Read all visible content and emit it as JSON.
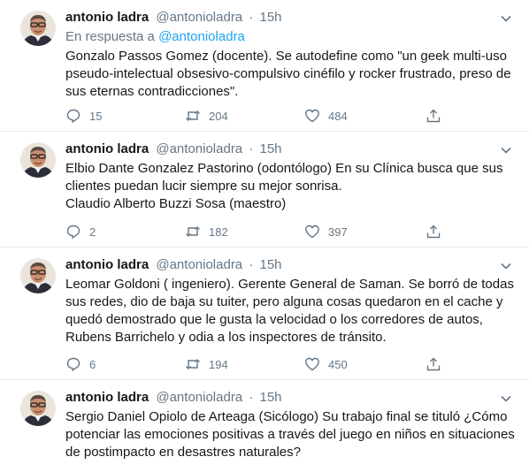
{
  "colors": {
    "text": "#14171a",
    "secondary": "#657786",
    "link": "#1da1f2",
    "divider": "#e6ecf0"
  },
  "tweets": [
    {
      "name": "antonio ladra",
      "handle": "@antonioladra",
      "separator": "·",
      "time": "15h",
      "reply_prefix": "En respuesta a",
      "reply_handle": "@antonioladra",
      "lines": [
        "Gonzalo Passos Gomez (docente). Se autodefine como \"un geek multi-uso pseudo-intelectual obsesivo-compulsivo cinéfilo y rocker frustrado, preso de sus eternas contradicciones\"."
      ],
      "replies": "15",
      "retweets": "204",
      "likes": "484"
    },
    {
      "name": "antonio ladra",
      "handle": "@antonioladra",
      "separator": "·",
      "time": "15h",
      "lines": [
        "Elbio Dante Gonzalez Pastorino (odontólogo) En su Clínica busca que sus clientes puedan lucir siempre su mejor sonrisa.",
        "Claudio Alberto Buzzi Sosa (maestro)"
      ],
      "replies": "2",
      "retweets": "182",
      "likes": "397"
    },
    {
      "name": "antonio ladra",
      "handle": "@antonioladra",
      "separator": "·",
      "time": "15h",
      "lines": [
        "Leomar Goldoni ( ingeniero). Gerente General de Saman. Se borró de todas sus redes, dio de baja su tuiter, pero alguna cosas quedaron en el cache y quedó demostrado que le gusta la velocidad o los corredores de autos, Rubens Barrichelo y odia a los inspectores de tránsito."
      ],
      "replies": "6",
      "retweets": "194",
      "likes": "450"
    },
    {
      "name": "antonio ladra",
      "handle": "@antonioladra",
      "separator": "·",
      "time": "15h",
      "lines": [
        "Sergio Daniel Opiolo de Arteaga (Sicólogo) Su trabajo final se tituló ¿Cómo potenciar las emociones positivas a través del juego en niños en situaciones de postimpacto en desastres naturales?"
      ]
    }
  ]
}
